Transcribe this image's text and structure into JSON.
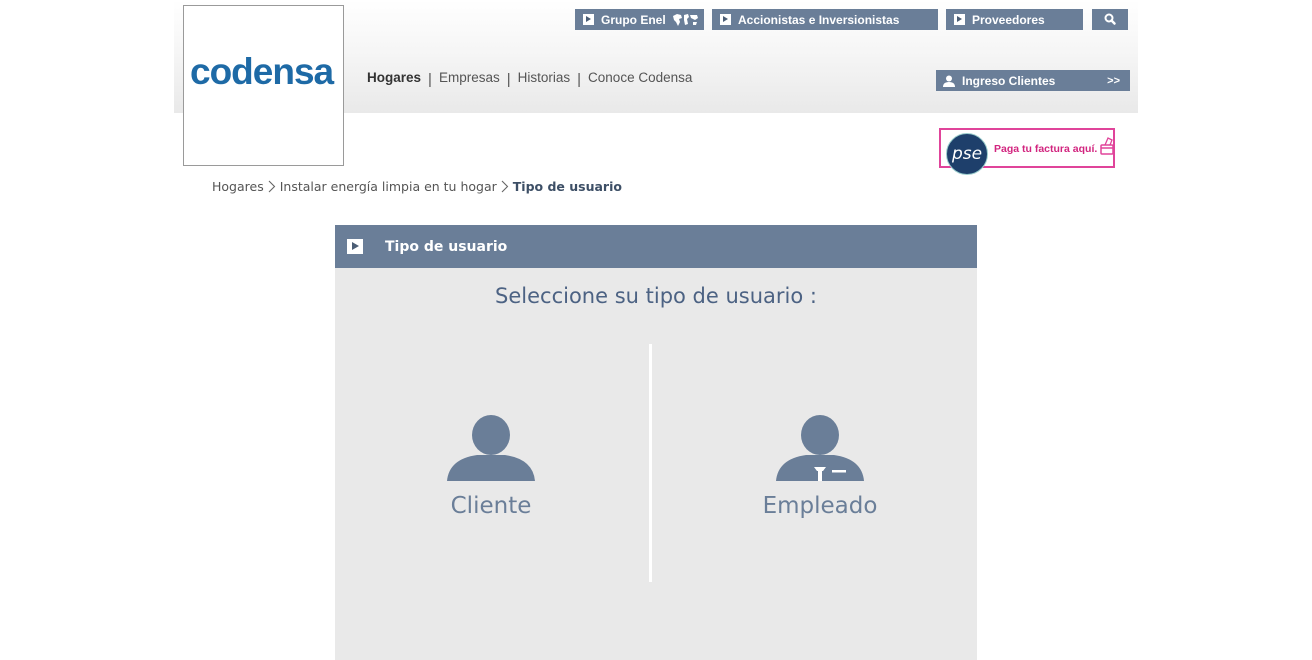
{
  "brand": {
    "logo_text": "codensa"
  },
  "top_nav": {
    "grupo_enel": "Grupo Enel",
    "accionistas": "Accionistas e Inversionistas",
    "proveedores": "Proveedores",
    "search_icon": "search-icon"
  },
  "main_nav": {
    "items": [
      "Hogares",
      "Empresas",
      "Historias",
      "Conoce Codensa"
    ],
    "separator": "|"
  },
  "login": {
    "label": "Ingreso Clientes",
    "chevron": ">>"
  },
  "pse": {
    "logo": "pse",
    "text": "Paga tu factura aquí."
  },
  "breadcrumb": {
    "items": [
      "Hogares",
      "Instalar energía limpia en tu hogar"
    ],
    "current": "Tipo de usuario"
  },
  "panel": {
    "title": "Tipo de usuario",
    "prompt": "Seleccione su tipo de usuario :",
    "options": [
      {
        "label": "Cliente",
        "icon": "user-icon"
      },
      {
        "label": "Empleado",
        "icon": "employee-icon"
      }
    ]
  },
  "colors": {
    "accent": "#6a7e98",
    "brand_blue": "#1e6aa6",
    "pse_pink": "#e0449a",
    "panel_bg": "#e9e9e9"
  }
}
